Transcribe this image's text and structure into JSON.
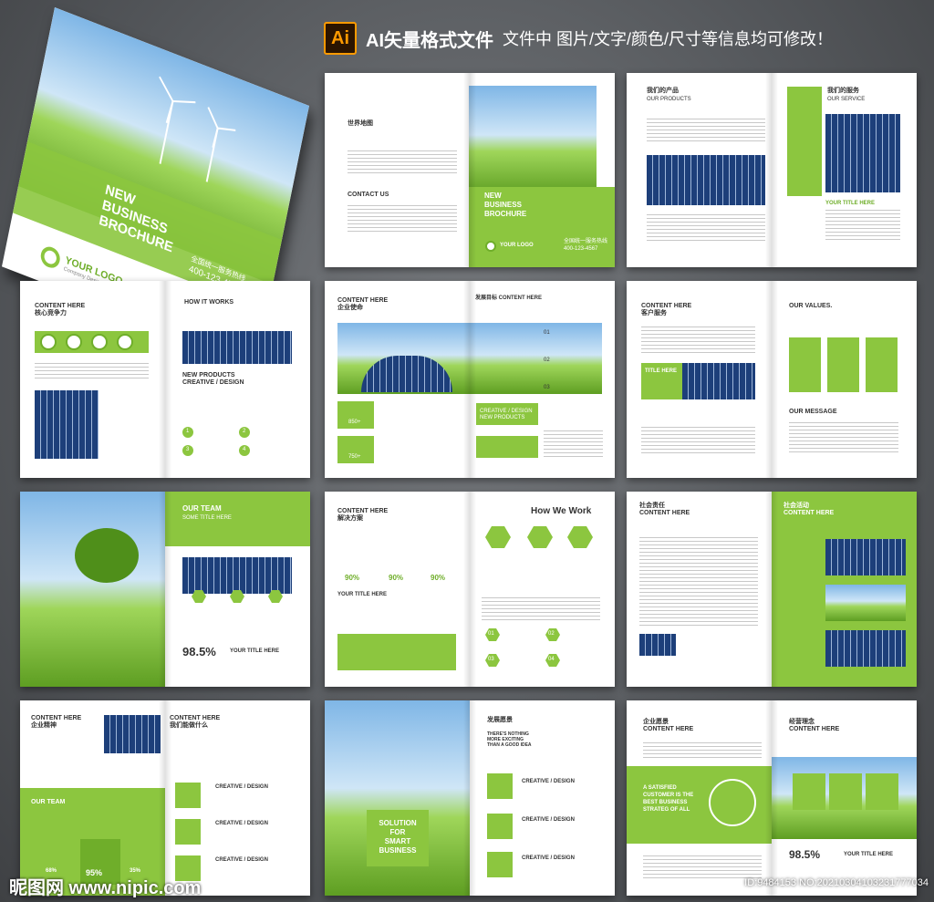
{
  "header": {
    "ai_badge": "Ai",
    "title": "AI矢量格式文件",
    "subtitle": "文件中 图片/文字/颜色/尺寸等信息均可修改！"
  },
  "cover": {
    "title_lines": [
      "NEW",
      "BUSINESS",
      "BROCHURE"
    ],
    "hotline": "全国统一服务热线",
    "phone": "400-123-4567",
    "logo": "YOUR LOGO",
    "logo_sub": "Company Design"
  },
  "s1": {
    "heading": "世界地图",
    "contact": "CONTACT US",
    "cover_title_lines": [
      "NEW",
      "BUSINESS",
      "BROCHURE"
    ],
    "logo": "YOUR LOGO",
    "hotline": "全国统一服务热线",
    "phone": "400-123-4567"
  },
  "s2": {
    "left_title": "我们的产品",
    "left_sub": "OUR PRODUCTS",
    "right_title": "我们的服务",
    "right_sub": "OUR SERVICE",
    "item": "YOUR TITLE HERE"
  },
  "s3": {
    "title": "CONTENT HERE",
    "title_cn": "核心竞争力",
    "how": "HOW IT WORKS",
    "new": "NEW PRODUCTS",
    "creative": "CREATIVE / DESIGN",
    "nums": [
      "1",
      "2",
      "3",
      "4"
    ]
  },
  "s4": {
    "title": "CONTENT HERE",
    "title_cn": "企业使命",
    "right_title": "发展目标  CONTENT HERE",
    "v1": "850+",
    "v2": "750+",
    "box1": "CREATIVE / DESIGN\nNEW PRODUCTS",
    "nums": [
      "01",
      "02",
      "03"
    ]
  },
  "s5": {
    "title": "CONTENT HERE",
    "title_cn": "客户服务",
    "values": "OUR VALUES.",
    "message": "OUR MESSAGE",
    "title_here": "TITLE HERE"
  },
  "s6": {
    "team": "OUR TEAM",
    "some": "SOME TITLE HERE",
    "pct": "98.5%",
    "your_title": "YOUR TITLE HERE"
  },
  "s7": {
    "title": "CONTENT HERE",
    "title_cn": "解决方案",
    "how": "How We Work",
    "pct": "90%",
    "your_title": "YOUR TITLE HERE",
    "nums": [
      "01",
      "02",
      "03",
      "04"
    ]
  },
  "s8": {
    "left_cn": "社会责任",
    "left_title": "CONTENT HERE",
    "right_cn": "社会活动",
    "right_title": "CONTENT HERE"
  },
  "s9": {
    "title": "CONTENT HERE",
    "title_cn": "企业精神",
    "team": "OUR TEAM",
    "right_title": "CONTENT HERE",
    "right_cn": "我们能做什么",
    "creative": "CREATIVE / DESIGN",
    "pcts": [
      "68%",
      "95%",
      "35%"
    ]
  },
  "s10": {
    "solution_lines": [
      "SOLUTION",
      "FOR",
      "SMART",
      "BUSINESS"
    ],
    "right_cn": "发展愿景",
    "right_title": "THERE'S NOTHING MORE EXCITING THAN A GOOD IDEA",
    "creative": "CREATIVE / DESIGN"
  },
  "s11": {
    "left_cn": "企业愿景",
    "left_title": "CONTENT HERE",
    "quote_lines": [
      "A SATISFIED",
      "CUSTOMER IS THE",
      "BEST BUSINESS",
      "STRATEG OF ALL"
    ],
    "right_cn": "经营理念",
    "right_title": "CONTENT HERE",
    "pct": "98.5%",
    "your_title": "YOUR TITLE HERE"
  },
  "watermark": {
    "left": "昵图网 www.nipic.com",
    "right": "ID:9484153 NO:20210304103231777034"
  }
}
